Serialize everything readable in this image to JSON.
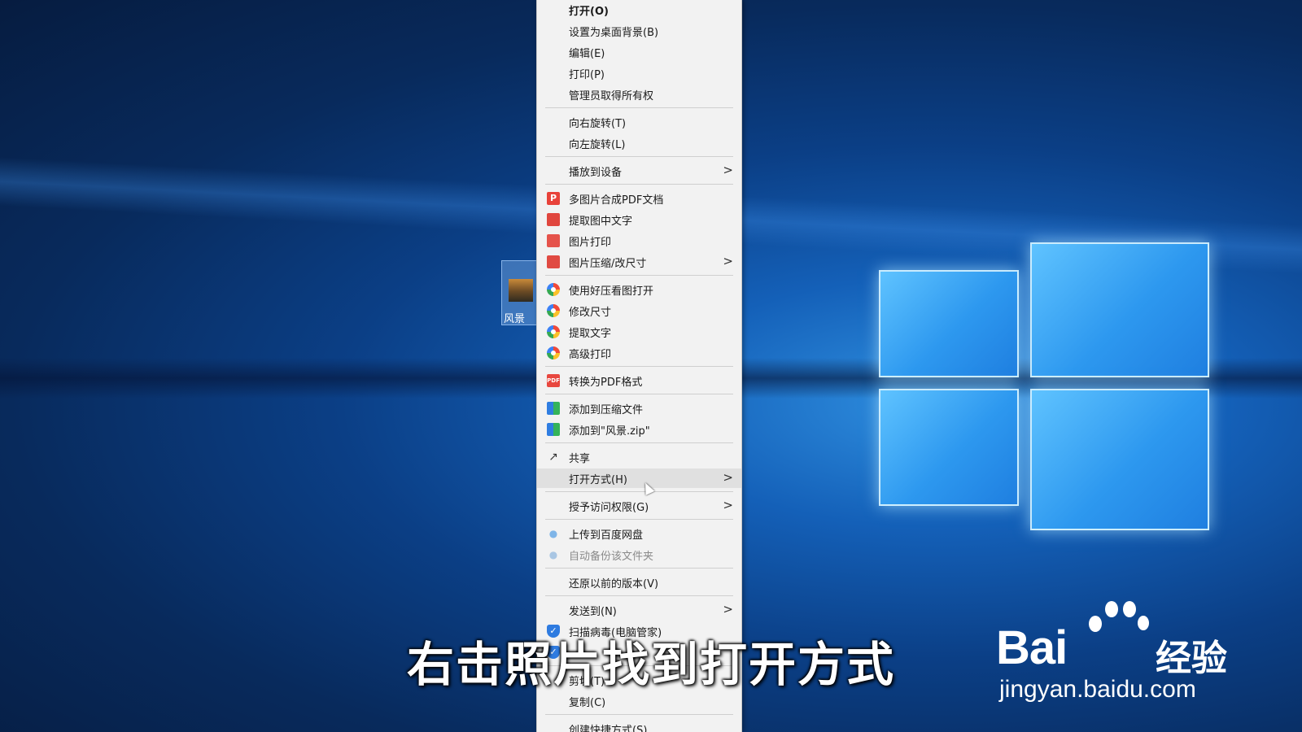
{
  "desktop": {
    "icon_label": "风景"
  },
  "context_menu": {
    "items": [
      {
        "id": "open",
        "label": "打开(O)",
        "icon": null,
        "submenu": false,
        "bold": true
      },
      {
        "id": "set-wallpaper",
        "label": "设置为桌面背景(B)",
        "icon": null,
        "submenu": false
      },
      {
        "id": "edit",
        "label": "编辑(E)",
        "icon": null,
        "submenu": false
      },
      {
        "id": "print",
        "label": "打印(P)",
        "icon": null,
        "submenu": false
      },
      {
        "id": "take-ownership",
        "label": "管理员取得所有权",
        "icon": null,
        "submenu": false
      },
      {
        "id": "rotate-right",
        "label": "向右旋转(T)",
        "icon": null,
        "submenu": false
      },
      {
        "id": "rotate-left",
        "label": "向左旋转(L)",
        "icon": null,
        "submenu": false
      },
      {
        "id": "cast-to-device",
        "label": "播放到设备",
        "icon": null,
        "submenu": true
      },
      {
        "id": "merge-pdf",
        "label": "多图片合成PDF文档",
        "icon": "pdf-merge-icon",
        "submenu": false
      },
      {
        "id": "extract-text-image",
        "label": "提取图中文字",
        "icon": "text-extract-icon",
        "submenu": false
      },
      {
        "id": "image-print",
        "label": "图片打印",
        "icon": "printer-icon",
        "submenu": false
      },
      {
        "id": "compress-resize",
        "label": "图片压缩/改尺寸",
        "icon": "compress-icon",
        "submenu": true
      },
      {
        "id": "open-haozip-viewer",
        "label": "使用好压看图打开",
        "icon": "haozip-viewer-icon",
        "submenu": false
      },
      {
        "id": "resize",
        "label": "修改尺寸",
        "icon": "haozip-viewer-icon",
        "submenu": false
      },
      {
        "id": "extract-text",
        "label": "提取文字",
        "icon": "haozip-viewer-icon",
        "submenu": false
      },
      {
        "id": "advanced-print",
        "label": "高级打印",
        "icon": "haozip-viewer-icon",
        "submenu": false
      },
      {
        "id": "convert-pdf",
        "label": "转换为PDF格式",
        "icon": "pdf-icon",
        "submenu": false
      },
      {
        "id": "add-archive",
        "label": "添加到压缩文件",
        "icon": "archive-icon",
        "submenu": false
      },
      {
        "id": "add-zip",
        "label": "添加到\"风景.zip\"",
        "icon": "archive-icon",
        "submenu": false
      },
      {
        "id": "share",
        "label": "共享",
        "icon": "share-icon",
        "submenu": false
      },
      {
        "id": "open-with",
        "label": "打开方式(H)",
        "icon": null,
        "submenu": true,
        "hover": true
      },
      {
        "id": "grant-access",
        "label": "授予访问权限(G)",
        "icon": null,
        "submenu": true
      },
      {
        "id": "upload-baidu",
        "label": "上传到百度网盘",
        "icon": "baidu-cloud-icon",
        "submenu": false
      },
      {
        "id": "auto-backup",
        "label": "自动备份该文件夹",
        "icon": "baidu-cloud-icon",
        "submenu": false,
        "disabled": true
      },
      {
        "id": "restore-versions",
        "label": "还原以前的版本(V)",
        "icon": null,
        "submenu": false
      },
      {
        "id": "send-to",
        "label": "发送到(N)",
        "icon": null,
        "submenu": true
      },
      {
        "id": "scan-virus",
        "label": "扫描病毒(电脑管家)",
        "icon": "shield-icon",
        "submenu": false
      },
      {
        "id": "pc-manager-2",
        "label": "",
        "icon": "shield-icon",
        "submenu": false
      },
      {
        "id": "cut",
        "label": "剪切(T)",
        "icon": null,
        "submenu": false
      },
      {
        "id": "copy",
        "label": "复制(C)",
        "icon": null,
        "submenu": false
      },
      {
        "id": "create-shortcut",
        "label": "创建快捷方式(S)",
        "icon": null,
        "submenu": false
      }
    ]
  },
  "caption": "右击照片找到打开方式",
  "watermark": {
    "brand": "Bai",
    "brand_suffix": "经验",
    "url": "jingyan.baidu.com"
  }
}
